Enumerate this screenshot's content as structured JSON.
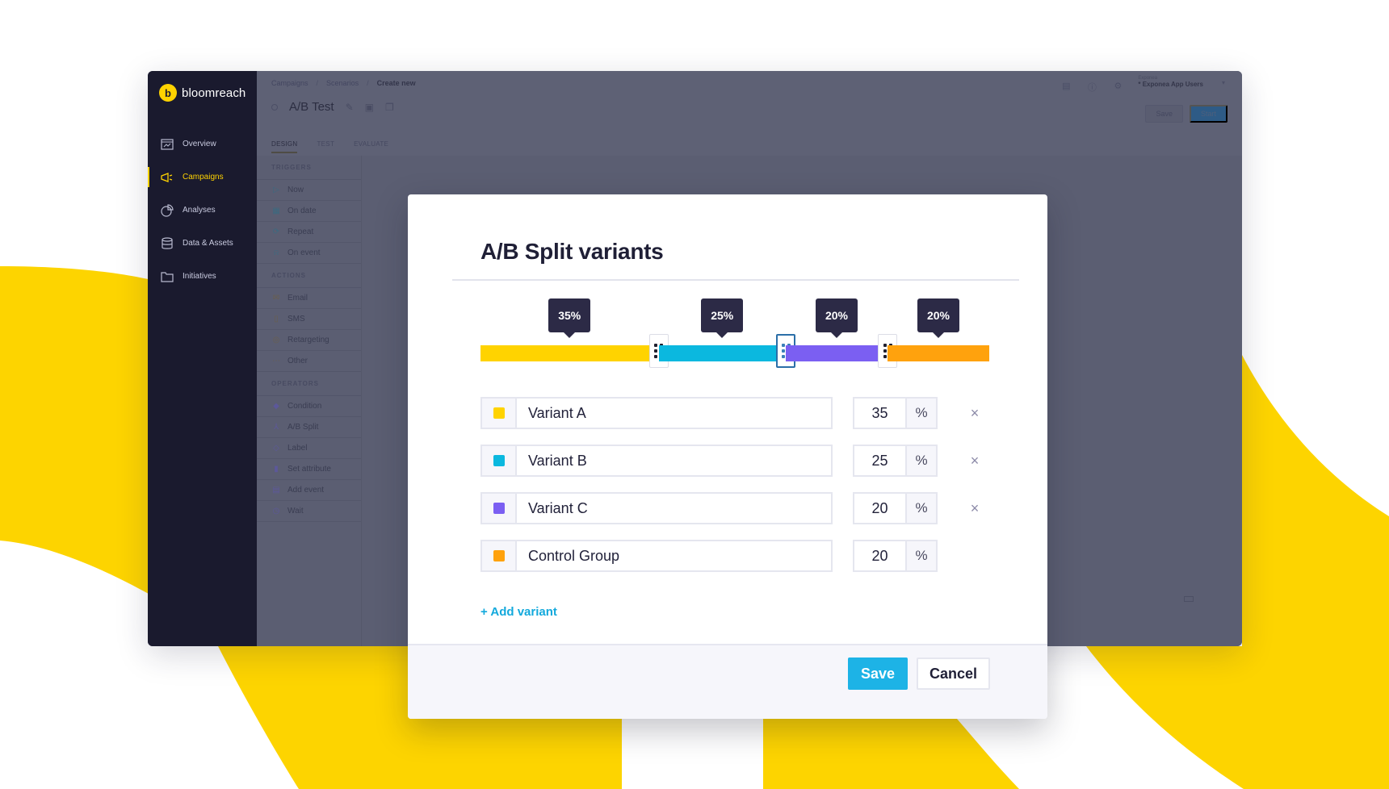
{
  "brand": {
    "name": "bloomreach",
    "accent": "#ffd300"
  },
  "sidebar": {
    "items": [
      {
        "label": "Overview",
        "icon": "dashboard-icon",
        "active": false
      },
      {
        "label": "Campaigns",
        "icon": "megaphone-icon",
        "active": true
      },
      {
        "label": "Analyses",
        "icon": "pie-chart-icon",
        "active": false
      },
      {
        "label": "Data & Assets",
        "icon": "database-icon",
        "active": false
      },
      {
        "label": "Initiatives",
        "icon": "folder-icon",
        "active": false
      }
    ]
  },
  "header": {
    "breadcrumb": [
      "Campaigns",
      "Scenarios",
      "Create new"
    ],
    "title": "A/B Test",
    "project_label": "Exponea",
    "project_name": "* Exponea App Users",
    "save_label": "Save",
    "start_label": "Start",
    "tabs": [
      "DESIGN",
      "TEST",
      "EVALUATE"
    ],
    "active_tab": "DESIGN"
  },
  "palette": {
    "sections": [
      {
        "title": "TRIGGERS",
        "kind": "trig",
        "items": [
          {
            "label": "Now",
            "glyph": "▷"
          },
          {
            "label": "On date",
            "glyph": "▦"
          },
          {
            "label": "Repeat",
            "glyph": "⟳"
          },
          {
            "label": "On event",
            "glyph": "⍾"
          }
        ]
      },
      {
        "title": "ACTIONS",
        "kind": "act",
        "items": [
          {
            "label": "Email",
            "glyph": "✉"
          },
          {
            "label": "SMS",
            "glyph": "▯"
          },
          {
            "label": "Retargeting",
            "glyph": "◎"
          },
          {
            "label": "Other",
            "glyph": "⋯"
          }
        ]
      },
      {
        "title": "OPERATORS",
        "kind": "op",
        "items": [
          {
            "label": "Condition",
            "glyph": "◆"
          },
          {
            "label": "A/B Split",
            "glyph": "⅄"
          },
          {
            "label": "Label",
            "glyph": "◇"
          },
          {
            "label": "Set attribute",
            "glyph": "▮"
          },
          {
            "label": "Add event",
            "glyph": "▤"
          },
          {
            "label": "Wait",
            "glyph": "◷"
          }
        ]
      }
    ]
  },
  "modal": {
    "title": "A/B Split variants",
    "variants": [
      {
        "name": "Variant A",
        "percent": 35,
        "percent_label": "35%",
        "color": "#ffd300",
        "removable": true
      },
      {
        "name": "Variant B",
        "percent": 25,
        "percent_label": "25%",
        "color": "#0bb8df",
        "removable": true
      },
      {
        "name": "Variant C",
        "percent": 20,
        "percent_label": "20%",
        "color": "#7b5ff2",
        "removable": true
      },
      {
        "name": "Control Group",
        "percent": 20,
        "percent_label": "20%",
        "color": "#ffa20d",
        "removable": false
      }
    ],
    "focused_handle": 1,
    "percent_unit": "%",
    "remove_glyph": "×",
    "add_variant_label": "+ Add variant",
    "save_label": "Save",
    "cancel_label": "Cancel"
  }
}
